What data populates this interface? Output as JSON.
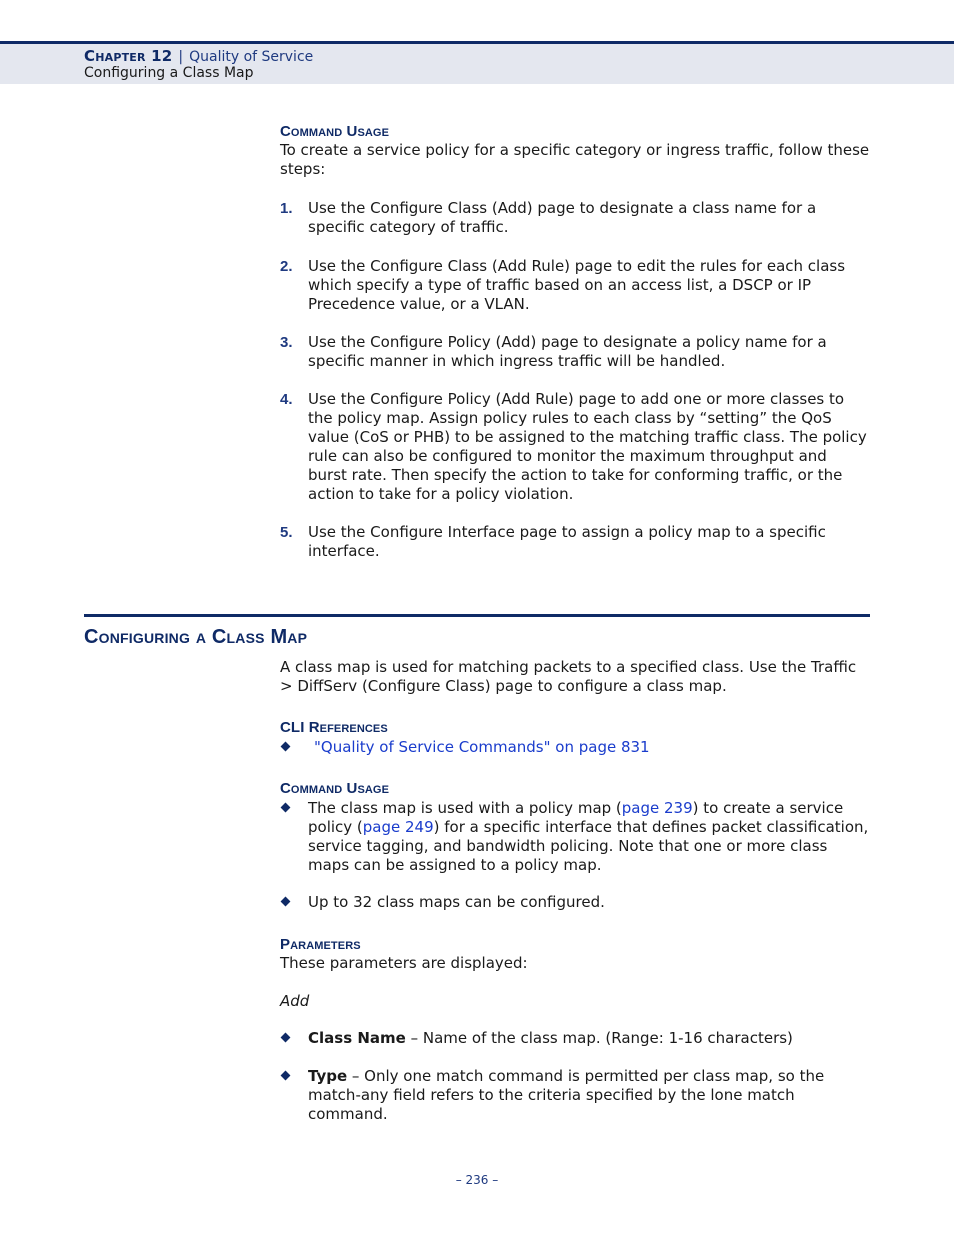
{
  "header": {
    "chapter": "Chapter 12",
    "separator": "|",
    "chapter_title": "Quality of Service",
    "section": "Configuring a Class Map"
  },
  "intro": {
    "heading": "Command Usage",
    "text": "To create a service policy for a specific category or ingress traffic, follow these steps:",
    "steps": [
      {
        "num": "1.",
        "text": "Use the Configure Class (Add) page to designate a class name for a specific category of traffic."
      },
      {
        "num": "2.",
        "text": "Use the Configure Class (Add Rule) page to edit the rules for each class which specify a type of traffic based on an access list, a DSCP or IP Precedence value, or a VLAN."
      },
      {
        "num": "3.",
        "text": "Use the Configure Policy (Add) page to designate a policy name for a specific manner in which ingress traffic will be handled."
      },
      {
        "num": "4.",
        "text": "Use the Configure Policy (Add Rule) page to add one or more classes to the policy map. Assign policy rules to each class by “setting” the QoS value (CoS or PHB) to be assigned to the matching traffic class. The policy rule can also be configured to monitor the maximum throughput and burst rate. Then specify the action to take for conforming traffic, or the action to take for a policy violation."
      },
      {
        "num": "5.",
        "text": "Use the Configure Interface page to assign a policy map to a specific interface."
      }
    ]
  },
  "section": {
    "title": "Configuring a Class Map",
    "description": "A class map is used for matching packets to a specified class. Use the Traffic > DiffServ (Configure Class) page to configure a class map.",
    "cli_heading": "CLI References",
    "cli_link": "\"Quality of Service Commands\" on page 831",
    "usage_heading": "Command Usage",
    "usage_bullets": {
      "b1_part1": "The class map is used with a policy map (",
      "b1_link1": "page 239",
      "b1_part2": ") to create a service policy (",
      "b1_link2": "page 249",
      "b1_part3": ") for a specific interface that defines packet classification, service tagging, and bandwidth policing. Note that one or more class maps can be assigned to a policy map.",
      "b2": "Up to 32 class maps can be configured."
    },
    "params_heading": "Parameters",
    "params_text": "These parameters are displayed:",
    "params_subhead": "Add",
    "params": [
      {
        "name": "Class Name",
        "desc": " – Name of the class map. (Range: 1-16 characters)"
      },
      {
        "name": "Type",
        "desc": " – Only one match command is permitted per class map, so the match-any field refers to the criteria specified by the lone match command."
      }
    ]
  },
  "footer": {
    "page_number": "–  236  –"
  }
}
